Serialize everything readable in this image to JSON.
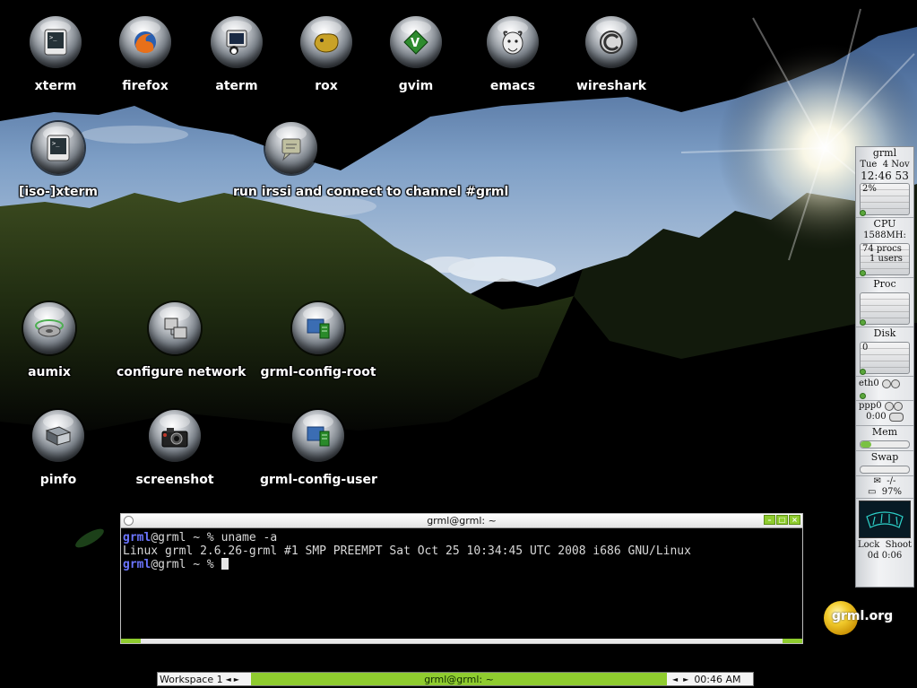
{
  "desktop": {
    "icons": [
      {
        "label": "xterm",
        "icon": "terminal-icon"
      },
      {
        "label": "firefox",
        "icon": "firefox-icon"
      },
      {
        "label": "aterm",
        "icon": "aterm-icon"
      },
      {
        "label": "rox",
        "icon": "rox-icon"
      },
      {
        "label": "gvim",
        "icon": "gvim-icon"
      },
      {
        "label": "emacs",
        "icon": "emacs-icon"
      },
      {
        "label": "wireshark",
        "icon": "wireshark-icon"
      },
      {
        "label": "[iso-]xterm",
        "icon": "terminal-icon"
      },
      {
        "label": "run irssi and connect to channel #grml",
        "icon": "irssi-icon"
      },
      {
        "label": "aumix",
        "icon": "speaker-icon"
      },
      {
        "label": "configure network",
        "icon": "network-icon"
      },
      {
        "label": "grml-config-root",
        "icon": "config-icon"
      },
      {
        "label": "pinfo",
        "icon": "book-icon"
      },
      {
        "label": "screenshot",
        "icon": "camera-icon"
      },
      {
        "label": "grml-config-user",
        "icon": "config-icon"
      }
    ]
  },
  "terminal": {
    "title": "grml@grml: ~",
    "lines": [
      {
        "user": "grml",
        "rest": "@grml ~ % uname -a"
      },
      {
        "output": "Linux grml 2.6.26-grml #1 SMP PREEMPT Sat Oct 25 10:34:45 UTC 2008 i686 GNU/Linux"
      },
      {
        "user": "grml",
        "rest": "@grml ~ % "
      }
    ]
  },
  "taskbar": {
    "workspace": "Workspace 1",
    "task": "grml@grml: ~",
    "clock": "00:46 AM"
  },
  "gkrellm": {
    "host": "grml",
    "day": "Tue",
    "date": "4 Nov",
    "time": "12:46 53",
    "load": "2%",
    "cpu_label": "CPU",
    "cpu_freq": "1588MH:",
    "procs": "74 procs",
    "users": "1 users",
    "proc_label": "Proc",
    "disk_label": "Disk",
    "disk_val": "0",
    "eth_label": "eth0",
    "ppp_label": "ppp0",
    "ppp_time": "0:00",
    "mem_label": "Mem",
    "swap_label": "Swap",
    "mail": "-/-",
    "battery": "97%",
    "lock": "Lock",
    "shoot": "Shoot",
    "uptime": "0d 0:06"
  },
  "logo": {
    "text": "grml.org"
  },
  "colors": {
    "accent": "#8fcc2f",
    "prompt": "#6b75ff"
  }
}
